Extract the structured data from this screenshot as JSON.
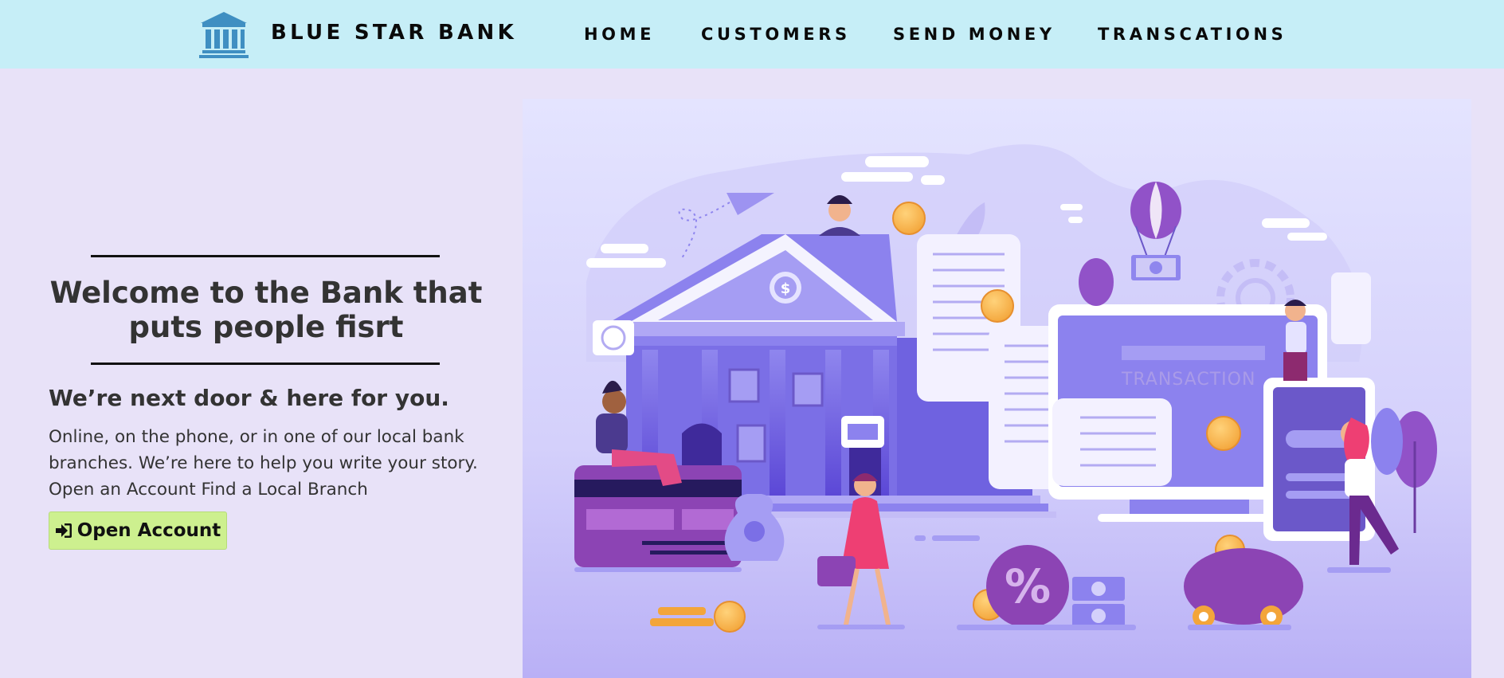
{
  "header": {
    "brand_name": "BLUE STAR BANK",
    "logo_icon": "bank-building-icon",
    "nav": [
      {
        "label": "HOME"
      },
      {
        "label": "CUSTOMERS"
      },
      {
        "label": "SEND MONEY"
      },
      {
        "label": "TRANSCATIONS"
      }
    ]
  },
  "hero": {
    "title": "Welcome to the Bank that puts people fisrt",
    "subheading": "We’re next door & here for you.",
    "body": "Online, on the phone, or in one of our local bank branches. We’re here to help you write your story. Open an Account Find a Local Branch",
    "button_label": "Open Account",
    "button_icon": "sign-in-icon"
  },
  "illustration": {
    "screen_text": "TRANSACTION"
  },
  "colors": {
    "header_bg": "#c6eef7",
    "page_bg": "#e8e2f8",
    "button_bg": "#cdf08f",
    "logo_blue": "#3f8fc2",
    "illustration_purple": "#7b68ee"
  }
}
